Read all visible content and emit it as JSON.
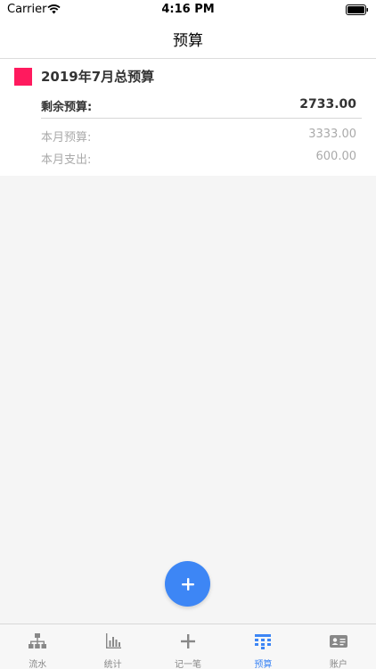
{
  "status_bar": {
    "carrier": "Carrier",
    "time": "4:16 PM"
  },
  "nav": {
    "title": "预算"
  },
  "budget_card": {
    "title": "2019年7月总预算",
    "swatch_color": "#ff1a5e",
    "remaining_label": "剩余预算:",
    "remaining_value": "2733.00",
    "budget_label": "本月预算:",
    "budget_value": "3333.00",
    "spent_label": "本月支出:",
    "spent_value": "600.00"
  },
  "fab": {
    "icon": "plus-icon"
  },
  "tabs": [
    {
      "label": "流水",
      "icon": "hierarchy-icon",
      "active": false
    },
    {
      "label": "统计",
      "icon": "bar-chart-icon",
      "active": false
    },
    {
      "label": "记一笔",
      "icon": "plus-icon",
      "active": false
    },
    {
      "label": "预算",
      "icon": "budget-table-icon",
      "active": true
    },
    {
      "label": "账户",
      "icon": "id-card-icon",
      "active": false
    }
  ],
  "colors": {
    "accent": "#3d86f5",
    "inactive": "#888888"
  }
}
